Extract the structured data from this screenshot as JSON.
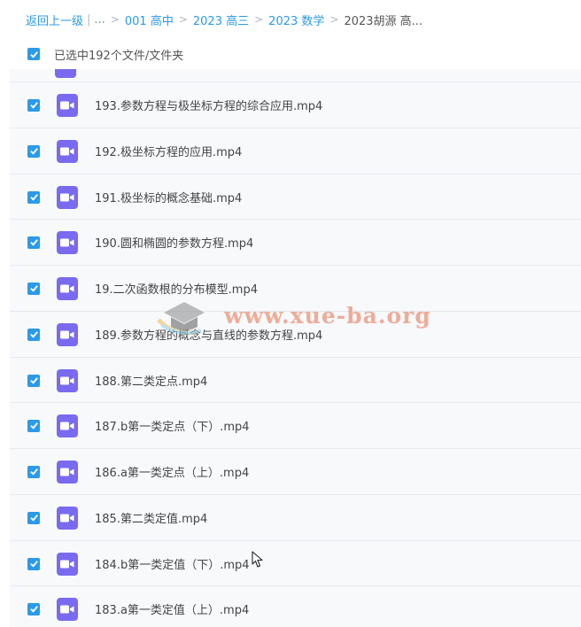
{
  "breadcrumb": {
    "back": "返回上一级",
    "ellipsis": "...",
    "items": [
      "001 高中",
      "2023 高三",
      "2023 数学"
    ],
    "current": "2023胡源 高..."
  },
  "selection": {
    "text": "已选中192个文件/文件夹",
    "checked": true
  },
  "files": [
    "193.参数方程与极坐标方程的综合应用.mp4",
    "192.极坐标方程的应用.mp4",
    "191.极坐标的概念基础.mp4",
    "190.圆和椭圆的参数方程.mp4",
    "19.二次函数根的分布模型.mp4",
    "189.参数方程的概念与直线的参数方程.mp4",
    "188.第二类定点.mp4",
    "187.b第一类定点（下）.mp4",
    "186.a第一类定点（上）.mp4",
    "185.第二类定值.mp4",
    "184.b第一类定值（下）.mp4",
    "183.a第一类定值（上）.mp4"
  ],
  "watermark": {
    "text": "www.xue-ba.org"
  },
  "colors": {
    "accent": "#2b9ae8",
    "video_icon": "#7a6af0",
    "watermark": "#e86e4a"
  },
  "icons": {
    "checkbox": "check-icon",
    "file": "video-file-icon",
    "cursor": "mouse-pointer-icon"
  }
}
